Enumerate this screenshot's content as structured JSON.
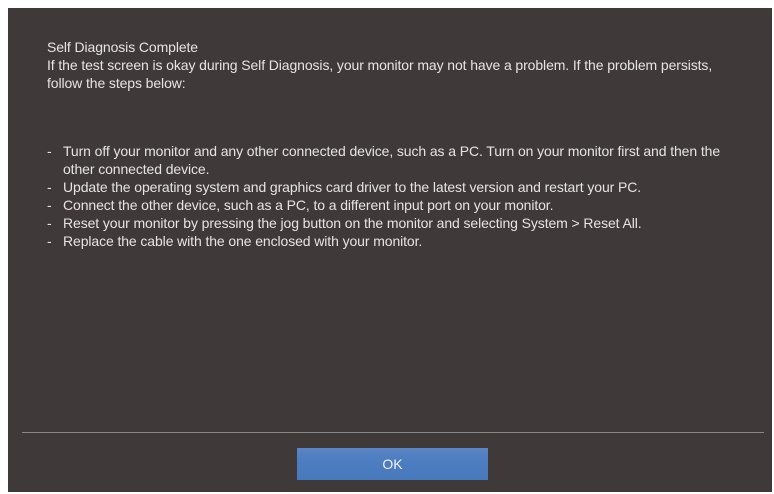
{
  "dialog": {
    "title": "Self Diagnosis Complete",
    "intro": "If the test screen is okay during Self Diagnosis, your monitor may not have a problem. If the problem persists, follow the steps below:",
    "bullet": "-",
    "steps": [
      "Turn off your monitor and any other connected device, such as a PC. Turn on your monitor first and then the other connected device.",
      "Update the operating system and graphics card driver to the latest version and restart your PC.",
      "Connect the other device, such as a PC, to a different input port on your monitor.",
      "Reset your monitor by pressing the jog button on the monitor and selecting System > Reset All.",
      "Replace the cable with the one enclosed with your monitor."
    ],
    "ok_label": "OK"
  },
  "colors": {
    "panel_background": "#3f3a39",
    "text": "#e6e4e2",
    "divider": "#8d8886",
    "button_accent": "#4679bd"
  }
}
